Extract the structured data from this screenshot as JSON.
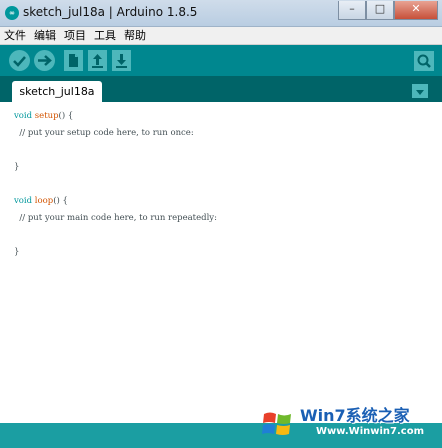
{
  "window": {
    "app_icon_label": "∞",
    "title": "sketch_jul18a | Arduino 1.8.5",
    "minimize_glyph": "–",
    "maximize_glyph": "□",
    "close_glyph": "✕"
  },
  "menu": {
    "items": [
      "文件",
      "编辑",
      "项目",
      "工具",
      "帮助"
    ]
  },
  "toolbar": {
    "buttons": [
      "verify-icon",
      "upload-icon",
      "new-icon",
      "open-icon",
      "save-icon"
    ],
    "right_button": "serial-monitor-icon",
    "accent": "#00878f"
  },
  "tabs": {
    "active": "sketch_jul18a",
    "menu_icon": "tab-menu-icon"
  },
  "editor": {
    "setup_kw": "void",
    "setup_fn": "setup",
    "setup_open": "() {",
    "setup_comment": "  // put your setup code here, to run once:",
    "setup_close": "}",
    "loop_kw": "void",
    "loop_fn": "loop",
    "loop_open": "() {",
    "loop_comment": "  // put your main code here, to run repeatedly:",
    "loop_close": "}"
  },
  "watermark": {
    "brand": "Win7系统之家",
    "url": "Www.Winwin7.com"
  }
}
